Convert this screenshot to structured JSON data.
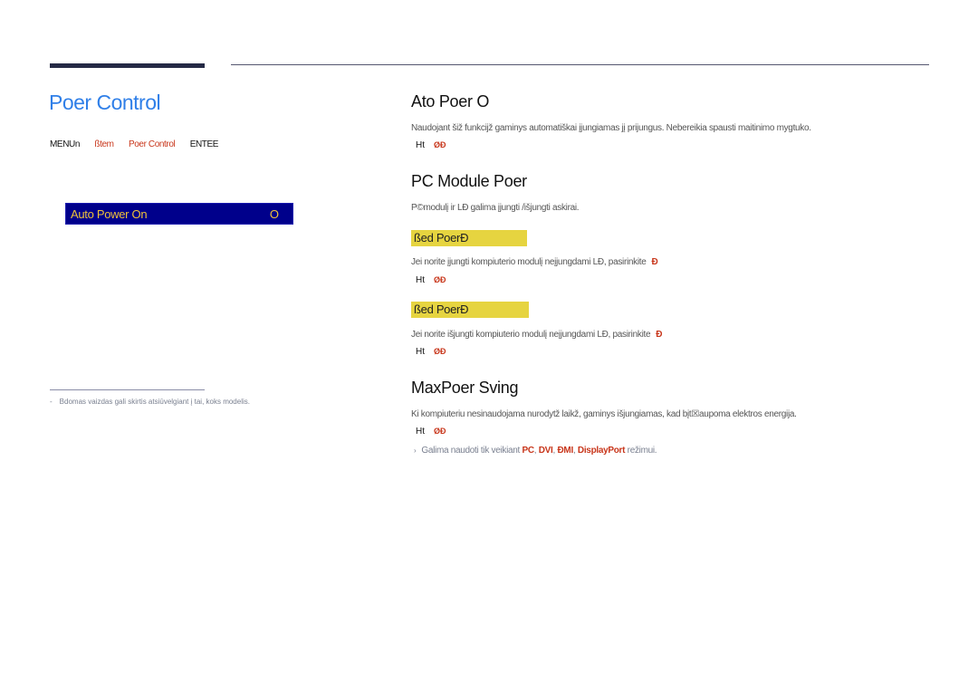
{
  "header": {
    "page_title": "Poer Control",
    "menu_path": [
      {
        "text": "MENUn",
        "style": "black"
      },
      {
        "text": "ßtem",
        "style": "red"
      },
      {
        "text": "Poer Control",
        "style": "red"
      },
      {
        "text": "ENTEE",
        "style": "black"
      }
    ]
  },
  "osd": {
    "label": "Auto Power On",
    "value": "O"
  },
  "footnote": {
    "dash": "-",
    "text": "Bdomas vaizdas gali skirtis atsiūvelgiant į tai, koks modelis."
  },
  "sections": {
    "auto_power_on": {
      "title": "Ato Poer O",
      "body": "Naudojant šiž funkcijž gaminys automatiškai įjungiamas jį prijungus. Nebereikia spausti maitinimo mygtuko.",
      "ht_label": "Ht",
      "ht_options": "ØĐ"
    },
    "pc_module_power": {
      "title": "PC Module Poer",
      "body": "P©modulį ir LÐ galima įjungti /išjungti askirai.",
      "synced_on": {
        "title": "ßed PoerÐ",
        "body": "Jei norite įjungti kompiuterio modulį neįjungdami LÐ, pasirinkite",
        "selected": "Ð",
        "ht_label": "Ht",
        "ht_options": "ØĐ"
      },
      "synced_off": {
        "title": "ßed PoerÐ",
        "body": "Jei norite išjungti kompiuterio modulį neįjungdami LÐ, pasirinkite",
        "selected": "Ð",
        "ht_label": "Ht",
        "ht_options": "ØĐ"
      }
    },
    "max_power_saving": {
      "title": "MaxPoer Sving",
      "body": "Ki kompiuteriu nesinaudojama nurodytž laikž, gaminys išjungiamas, kad bįt☒aupoma elektros energija.",
      "ht_label": "Ht",
      "ht_options": "ØĐ",
      "note": {
        "bullet": "›",
        "prefix": "Galima naudoti tik veikiant",
        "modes": [
          "PC",
          "DVI",
          "ÐMI",
          "DisplayPort"
        ],
        "suffix": "režimui."
      }
    }
  }
}
